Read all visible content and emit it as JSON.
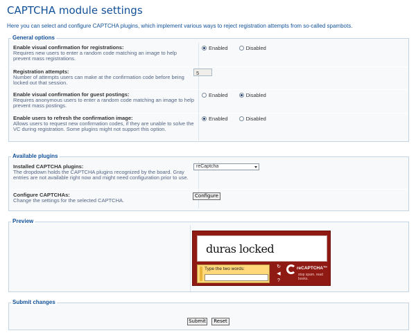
{
  "page": {
    "title": "CAPTCHA module settings",
    "intro": "Here you can select and configure CAPTCHA plugins, which implement various ways to reject registration attempts from so-called spambots."
  },
  "general": {
    "legend": "General options",
    "rows": [
      {
        "title": "Enable visual confirmation for registrations:",
        "desc": "Requires new users to enter a random code matching an image to help prevent mass registrations.",
        "opt_enabled": "Enabled",
        "opt_disabled": "Disabled",
        "selected": "Enabled"
      },
      {
        "title": "Registration attempts:",
        "desc": "Number of attempts users can make at the confirmation code before being locked out that session.",
        "value": "5"
      },
      {
        "title": "Enable visual confirmation for guest postings:",
        "desc": "Requires anonymous users to enter a random code matching an image to help prevent mass postings.",
        "opt_enabled": "Enabled",
        "opt_disabled": "Disabled",
        "selected": "Disabled"
      },
      {
        "title": "Enable users to refresh the confirmation image:",
        "desc": "Allows users to request new confirmation codes, if they are unable to solve the VC during registration. Some plugins might not support this option.",
        "opt_enabled": "Enabled",
        "opt_disabled": "Disabled",
        "selected": "Enabled"
      }
    ]
  },
  "plugins": {
    "legend": "Available plugins",
    "installed_title": "Installed CAPTCHA plugins:",
    "installed_desc": "The dropdown holds the CAPTCHA plugins recognized by the board. Gray entries are not available right now and might need configuration prior to use.",
    "selected_plugin": "reCaptcha",
    "configure_title": "Configure CAPTCHAs:",
    "configure_desc": "Change the settings for the selected CAPTCHA.",
    "configure_button": "Configure"
  },
  "preview": {
    "legend": "Preview",
    "captcha_words": "duras locked",
    "prompt": "Type the two words:",
    "brand": "reCAPTCHA™",
    "tagline": "stop spam. read books."
  },
  "submit": {
    "legend": "Submit changes",
    "submit_label": "Submit",
    "reset_label": "Reset"
  }
}
